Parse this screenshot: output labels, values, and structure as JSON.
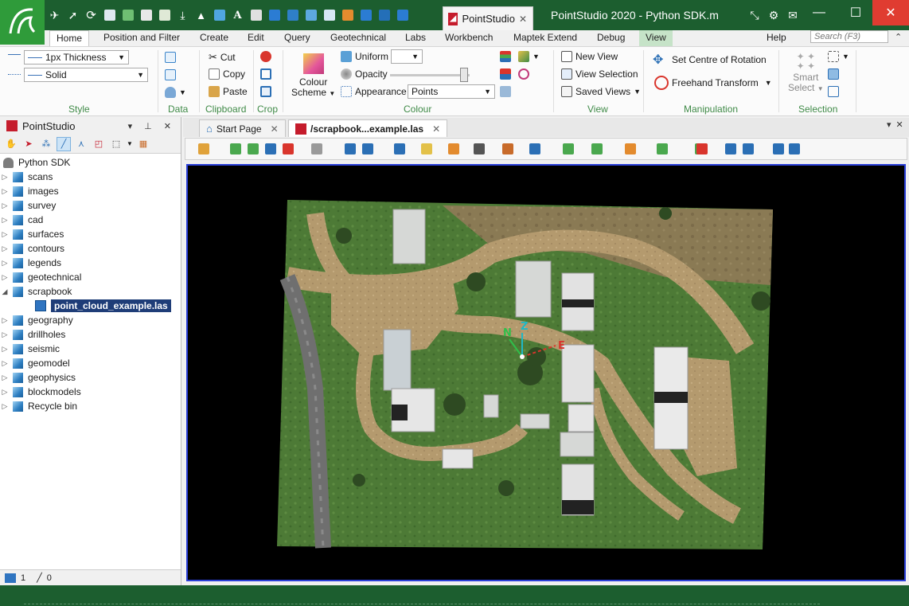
{
  "window": {
    "app_tab_label": "PointStudio",
    "title": "PointStudio 2020 - Python SDK.m"
  },
  "ribbon_tabs": [
    "Home",
    "Position and Filter",
    "Create",
    "Edit",
    "Query",
    "Geotechnical",
    "Labs",
    "Workbench",
    "Maptek Extend",
    "Debug",
    "View"
  ],
  "help_label": "Help",
  "search_placeholder": "Search (F3)",
  "ribbon": {
    "style": {
      "thickness": "1px Thickness",
      "line_style": "Solid",
      "label": "Style"
    },
    "data": {
      "label": "Data"
    },
    "clipboard": {
      "cut": "Cut",
      "copy": "Copy",
      "paste": "Paste",
      "label": "Clipboard"
    },
    "crop": {
      "label": "Crop"
    },
    "colour": {
      "scheme_line1": "Colour",
      "scheme_line2": "Scheme",
      "uniform": "Uniform",
      "opacity": "Opacity",
      "opacity_level": 0.98,
      "appearance": "Appearance",
      "appearance_value": "Points",
      "label": "Colour"
    },
    "view": {
      "new_view": "New View",
      "view_selection": "View Selection",
      "saved_views": "Saved Views",
      "label": "View"
    },
    "manipulation": {
      "set_centre": "Set Centre of Rotation",
      "freehand": "Freehand Transform",
      "label": "Manipulation"
    },
    "selection": {
      "smart_line1": "Smart",
      "smart_line2": "Select",
      "label": "Selection"
    }
  },
  "left_panel": {
    "title": "PointStudio",
    "root": "Python SDK",
    "items": [
      {
        "label": "scans",
        "expanded": false
      },
      {
        "label": "images",
        "expanded": false
      },
      {
        "label": "survey",
        "expanded": false
      },
      {
        "label": "cad",
        "expanded": false
      },
      {
        "label": "surfaces",
        "expanded": false
      },
      {
        "label": "contours",
        "expanded": false
      },
      {
        "label": "legends",
        "expanded": false
      },
      {
        "label": "geotechnical",
        "expanded": false
      },
      {
        "label": "scrapbook",
        "expanded": true
      },
      {
        "label": "geography",
        "expanded": false
      },
      {
        "label": "drillholes",
        "expanded": false
      },
      {
        "label": "seismic",
        "expanded": false
      },
      {
        "label": "geomodel",
        "expanded": false
      },
      {
        "label": "geophysics",
        "expanded": false
      },
      {
        "label": "blockmodels",
        "expanded": false
      },
      {
        "label": "Recycle bin",
        "expanded": false
      }
    ],
    "selected_child": "point_cloud_example.las",
    "footer_selected": "1",
    "footer_total": "0"
  },
  "doc_tabs": {
    "start": "Start Page",
    "active": "/scrapbook...example.las"
  },
  "axes": {
    "north": "N",
    "up": "Z",
    "east": "E"
  },
  "colors": {
    "title_green": "#1c5e2f",
    "logo_green": "#2f9b3a",
    "group_label": "#3f8a47",
    "view_tab": "#c6e3c8",
    "selection_blue": "#1f3d78",
    "viewport_border": "#2a3fd8"
  }
}
